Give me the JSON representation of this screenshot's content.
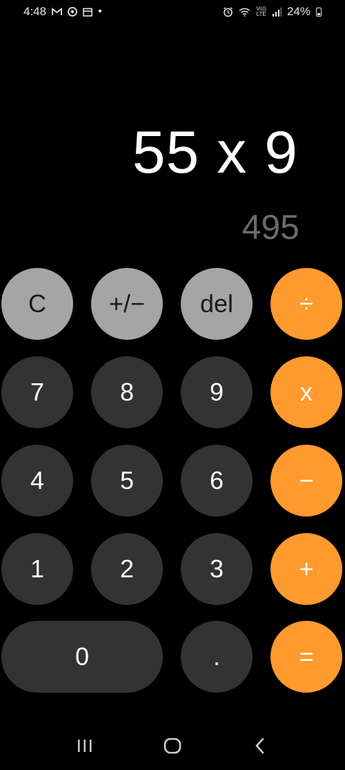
{
  "status_bar": {
    "time": "4:48",
    "battery": "24%",
    "network": "LTE",
    "volte": "Vo))"
  },
  "display": {
    "expression": "55 x 9",
    "result": "495"
  },
  "keys": {
    "clear": "C",
    "sign": "+/−",
    "delete": "del",
    "divide": "÷",
    "seven": "7",
    "eight": "8",
    "nine": "9",
    "multiply": "x",
    "four": "4",
    "five": "5",
    "six": "6",
    "subtract": "−",
    "one": "1",
    "two": "2",
    "three": "3",
    "add": "+",
    "zero": "0",
    "decimal": ".",
    "equals": "="
  },
  "colors": {
    "background": "#000000",
    "function_key": "#a5a5a5",
    "number_key": "#333333",
    "operator_key": "#ff9a2e",
    "result_text": "#6b6b6b"
  },
  "icons": {
    "status_left": [
      "gmail-icon",
      "chrome-icon",
      "calendar-icon",
      "notification-dot-icon"
    ],
    "status_right": [
      "alarm-icon",
      "wifi-icon",
      "volte-icon",
      "signal-icon",
      "battery-icon"
    ],
    "nav": [
      "recents-icon",
      "home-icon",
      "back-icon"
    ]
  }
}
